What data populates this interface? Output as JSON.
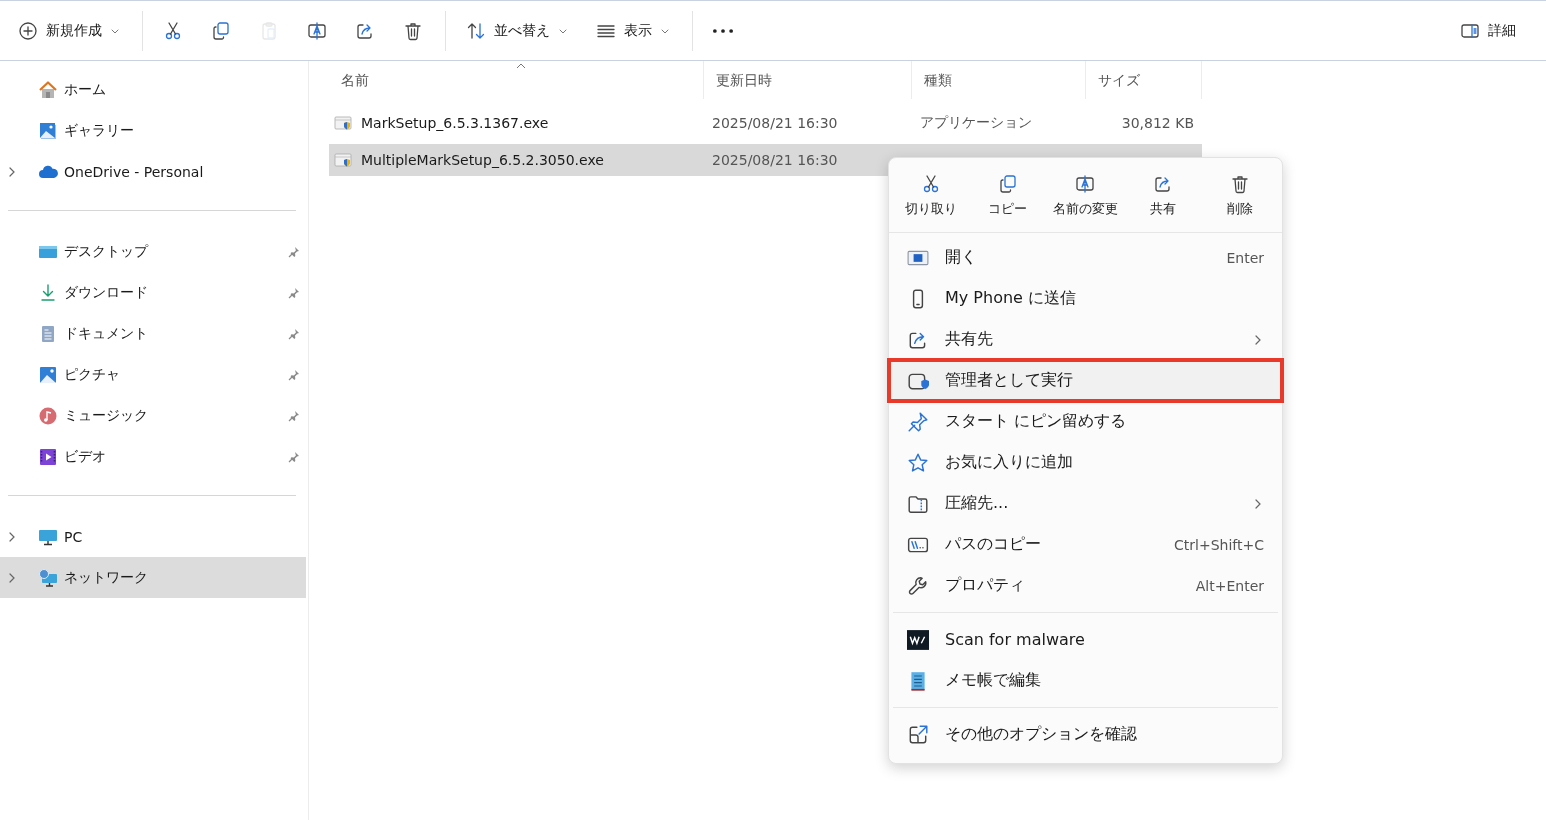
{
  "toolbar": {
    "left": [
      {
        "kind": "new",
        "label": "新規作成",
        "dropdown": true,
        "disabled": false
      },
      {
        "kind": "cut",
        "dropdown": false,
        "disabled": false
      },
      {
        "kind": "copy",
        "dropdown": false,
        "disabled": false
      },
      {
        "kind": "paste",
        "dropdown": false,
        "disabled": true
      },
      {
        "kind": "rename",
        "dropdown": false,
        "disabled": false
      },
      {
        "kind": "share",
        "dropdown": false,
        "disabled": false
      },
      {
        "kind": "delete",
        "dropdown": false,
        "disabled": false
      },
      {
        "kind": "sort",
        "label": "並べ替え",
        "dropdown": true,
        "disabled": false
      },
      {
        "kind": "view",
        "label": "表示",
        "dropdown": true,
        "disabled": false
      },
      {
        "kind": "more",
        "dropdown": false,
        "disabled": false
      }
    ],
    "right": {
      "kind": "details",
      "label": "詳細"
    }
  },
  "sidebar": {
    "groups": [
      {
        "items": [
          {
            "kind": "home",
            "label": "ホーム",
            "expandable": false,
            "pinned": false,
            "selected": false
          },
          {
            "kind": "gallery",
            "label": "ギャラリー",
            "expandable": false,
            "pinned": false,
            "selected": false
          },
          {
            "kind": "onedrive",
            "label": "OneDrive - Personal",
            "expandable": true,
            "pinned": false,
            "selected": false
          }
        ]
      },
      {
        "items": [
          {
            "kind": "desktop",
            "label": "デスクトップ",
            "expandable": false,
            "pinned": true,
            "selected": false
          },
          {
            "kind": "download",
            "label": "ダウンロード",
            "expandable": false,
            "pinned": true,
            "selected": false
          },
          {
            "kind": "document",
            "label": "ドキュメント",
            "expandable": false,
            "pinned": true,
            "selected": false
          },
          {
            "kind": "pictures",
            "label": "ピクチャ",
            "expandable": false,
            "pinned": true,
            "selected": false
          },
          {
            "kind": "music",
            "label": "ミュージック",
            "expandable": false,
            "pinned": true,
            "selected": false
          },
          {
            "kind": "video",
            "label": "ビデオ",
            "expandable": false,
            "pinned": true,
            "selected": false
          }
        ]
      },
      {
        "items": [
          {
            "kind": "pc",
            "label": "PC",
            "expandable": true,
            "pinned": false,
            "selected": false
          },
          {
            "kind": "network",
            "label": "ネットワーク",
            "expandable": true,
            "pinned": false,
            "selected": true
          }
        ]
      }
    ]
  },
  "table": {
    "columns": [
      {
        "label": "名前",
        "sorted": true
      },
      {
        "label": "更新日時",
        "sorted": false
      },
      {
        "label": "種類",
        "sorted": false
      },
      {
        "label": "サイズ",
        "sorted": false
      }
    ],
    "rows": [
      {
        "name": "MarkSetup_6.5.3.1367.exe",
        "modified": "2025/08/21 16:30",
        "type": "アプリケーション",
        "size": "30,812 KB",
        "selected": false
      },
      {
        "name": "MultipleMarkSetup_6.5.2.3050.exe",
        "modified": "2025/08/21 16:30",
        "selected": true
      }
    ]
  },
  "context_menu": {
    "actions": [
      {
        "kind": "cut",
        "label": "切り取り"
      },
      {
        "kind": "copy",
        "label": "コピー"
      },
      {
        "kind": "rename",
        "label": "名前の変更"
      },
      {
        "kind": "share",
        "label": "共有"
      },
      {
        "kind": "delete",
        "label": "削除"
      }
    ],
    "sections": [
      {
        "items": [
          {
            "kind": "open",
            "label": "開く",
            "shortcut": "Enter",
            "submenu": false,
            "highlighted": false
          },
          {
            "kind": "phone",
            "label": "My Phone に送信",
            "submenu": false,
            "highlighted": false
          },
          {
            "kind": "share",
            "label": "共有先",
            "submenu": true,
            "highlighted": false
          },
          {
            "kind": "shield",
            "label": "管理者として実行",
            "submenu": false,
            "highlighted": true
          },
          {
            "kind": "pin",
            "label": "スタート にピン留めする",
            "submenu": false,
            "highlighted": false
          },
          {
            "kind": "star",
            "label": "お気に入りに追加",
            "submenu": false,
            "highlighted": false
          },
          {
            "kind": "zip",
            "label": "圧縮先...",
            "submenu": true,
            "highlighted": false
          },
          {
            "kind": "path",
            "label": "パスのコピー",
            "shortcut": "Ctrl+Shift+C",
            "submenu": false,
            "highlighted": false
          },
          {
            "kind": "wrench",
            "label": "プロパティ",
            "shortcut": "Alt+Enter",
            "submenu": false,
            "highlighted": false
          }
        ]
      },
      {
        "items": [
          {
            "kind": "malware",
            "label": "Scan for malware",
            "submenu": false,
            "highlighted": false
          },
          {
            "kind": "notepad",
            "label": "メモ帳で編集",
            "submenu": false,
            "highlighted": false
          }
        ]
      },
      {
        "items": [
          {
            "kind": "external",
            "label": "その他のオプションを確認",
            "submenu": false,
            "highlighted": false
          }
        ]
      }
    ]
  }
}
